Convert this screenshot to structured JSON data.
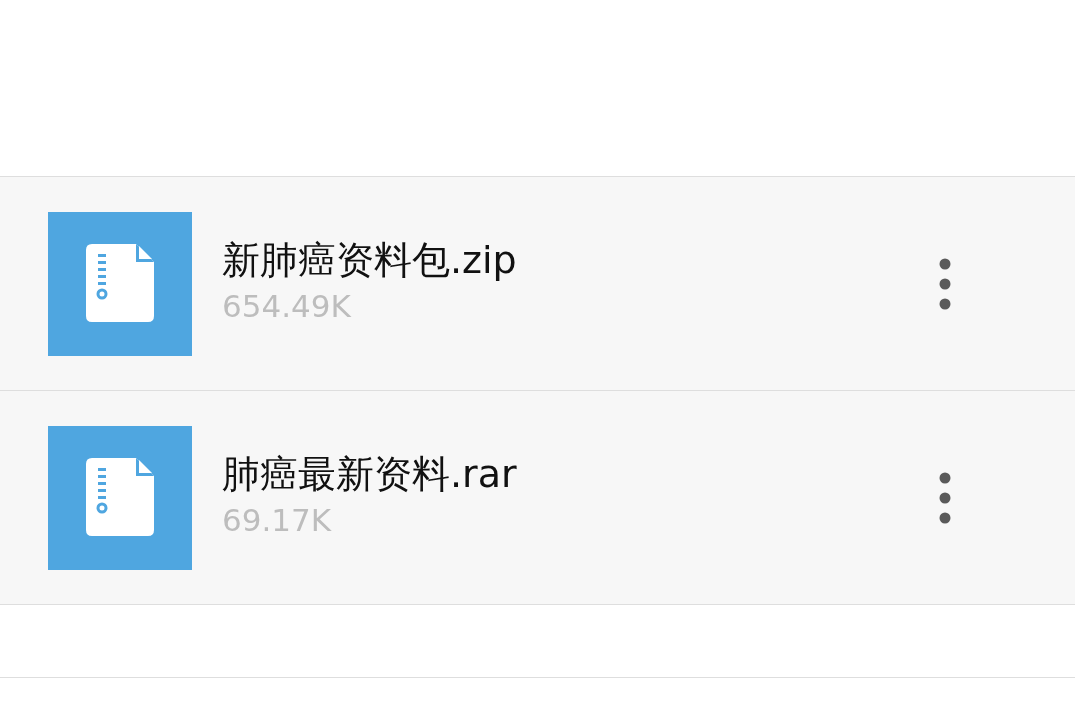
{
  "files": [
    {
      "name": "新肺癌资料包.zip",
      "size": "654.49K"
    },
    {
      "name": "肺癌最新资料.rar",
      "size": "69.17K"
    }
  ]
}
